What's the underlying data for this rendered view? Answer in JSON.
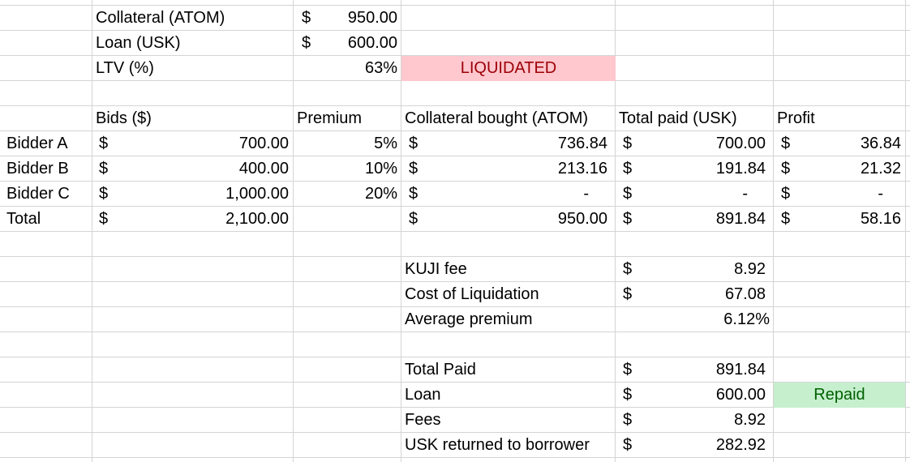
{
  "summary": {
    "collateral_label": "Collateral (ATOM)",
    "collateral_currency": "$",
    "collateral_value": "950.00",
    "loan_label": "Loan (USK)",
    "loan_currency": "$",
    "loan_value": "600.00",
    "ltv_label": "LTV (%)",
    "ltv_value": "63%",
    "status": "LIQUIDATED"
  },
  "bids_table": {
    "headers": {
      "bids": "Bids ($)",
      "premium": "Premium",
      "collateral_bought": "Collateral bought (ATOM)",
      "total_paid": "Total paid (USK)",
      "profit": "Profit"
    },
    "rows": [
      {
        "name": "Bidder A",
        "bid_cur": "$",
        "bid": "700.00",
        "premium": "5%",
        "cb_cur": "$",
        "cb": "736.84",
        "tp_cur": "$",
        "tp": "700.00",
        "pr_cur": "$",
        "pr": "36.84"
      },
      {
        "name": "Bidder B",
        "bid_cur": "$",
        "bid": "400.00",
        "premium": "10%",
        "cb_cur": "$",
        "cb": "213.16",
        "tp_cur": "$",
        "tp": "191.84",
        "pr_cur": "$",
        "pr": "21.32"
      },
      {
        "name": "Bidder C",
        "bid_cur": "$",
        "bid": "1,000.00",
        "premium": "20%",
        "cb_cur": "$",
        "cb": "-",
        "tp_cur": "$",
        "tp": "-",
        "pr_cur": "$",
        "pr": "-"
      },
      {
        "name": "Total",
        "bid_cur": "$",
        "bid": "2,100.00",
        "premium": "",
        "cb_cur": "$",
        "cb": "950.00",
        "tp_cur": "$",
        "tp": "891.84",
        "pr_cur": "$",
        "pr": "58.16"
      }
    ]
  },
  "fees": {
    "kuji_label": "KUJI fee",
    "kuji_cur": "$",
    "kuji_value": "8.92",
    "cost_label": "Cost of Liquidation",
    "cost_cur": "$",
    "cost_value": "67.08",
    "avg_label": "Average premium",
    "avg_value": "6.12%"
  },
  "repayment": {
    "total_paid_label": "Total Paid",
    "total_paid_cur": "$",
    "total_paid_value": "891.84",
    "loan_label": "Loan",
    "loan_cur": "$",
    "loan_value": "600.00",
    "fees_label": "Fees",
    "fees_cur": "$",
    "fees_value": "8.92",
    "returned_label": "USK returned to borrower",
    "returned_cur": "$",
    "returned_value": "282.92",
    "status": "Repaid"
  },
  "colors": {
    "liquidated_fill": "#ffc7ce",
    "liquidated_text": "#9c0006",
    "repaid_fill": "#c6efce",
    "repaid_text": "#006100",
    "gridline": "#d4d4d4"
  }
}
